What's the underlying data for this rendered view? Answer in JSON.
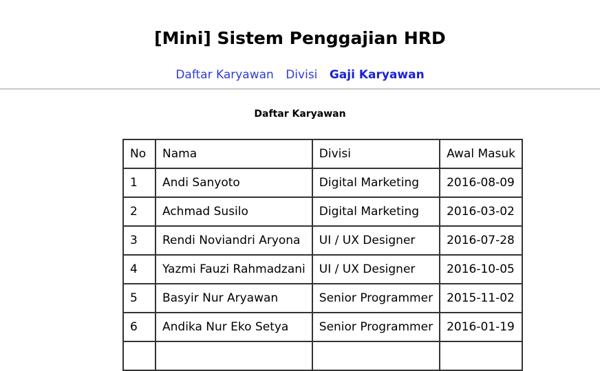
{
  "site": {
    "title": "[Mini] Sistem Penggajian HRD"
  },
  "nav": {
    "items": [
      {
        "label": "Daftar Karyawan",
        "active": false
      },
      {
        "label": "Divisi",
        "active": false
      },
      {
        "label": "Gaji Karyawan",
        "active": true
      }
    ]
  },
  "main": {
    "section_title": "Daftar Karyawan",
    "table": {
      "headers": [
        "No",
        "Nama",
        "Divisi",
        "Awal Masuk"
      ],
      "rows": [
        [
          "1",
          "Andi Sanyoto",
          "Digital Marketing",
          "2016-08-09"
        ],
        [
          "2",
          "Achmad Susilo",
          "Digital Marketing",
          "2016-03-02"
        ],
        [
          "3",
          "Rendi Noviandri Aryona",
          "UI / UX Designer",
          "2016-07-28"
        ],
        [
          "4",
          "Yazmi Fauzi Rahmadzani",
          "UI / UX Designer",
          "2016-10-05"
        ],
        [
          "5",
          "Basyir Nur Aryawan",
          "Senior Programmer",
          "2015-11-02"
        ],
        [
          "6",
          "Andika Nur Eko Setya",
          "Senior Programmer",
          "2016-01-19"
        ],
        [
          "",
          "",
          "",
          ""
        ]
      ]
    }
  },
  "colors": {
    "link": "#2f3bd9",
    "link_active": "#1c22d4",
    "table_border": "#333333",
    "divider": "#9a9a9a"
  }
}
